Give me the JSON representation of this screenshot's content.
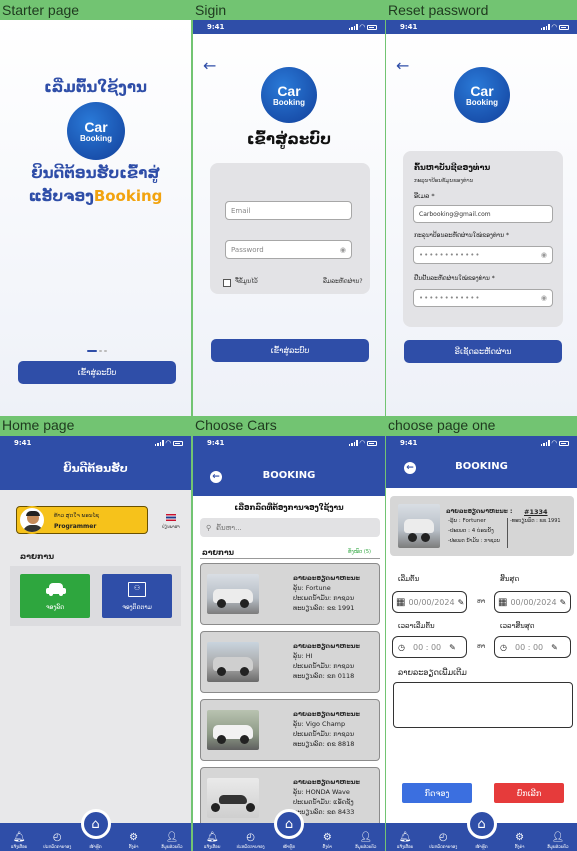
{
  "labels": {
    "starter": "Starter page",
    "signin": "Sigin",
    "reset": "Reset password",
    "home": "Home page",
    "choose": "Choose Cars",
    "choose_one": "choose page one"
  },
  "status": {
    "time": "9:41"
  },
  "logo": {
    "line1": "Car",
    "line2": "Booking"
  },
  "starter": {
    "title_top": "ເລີ່ມຕົ້ນໃຊ້ງານ",
    "welcome_line1": "ຍິນດີຕ້ອນຮັບເຂົ້າສູ່",
    "welcome_line2_prefix": "ແອັບຈອງ",
    "welcome_line2_brand": "Booking",
    "login_button": "ເຂົ້າສູ່ລະບົບ"
  },
  "signin": {
    "title": "ເຂົ້າສູ່ລະບົບ",
    "email_placeholder": "Email",
    "password_placeholder": "Password",
    "remember_label": "ຈື່ຂໍ້ມູນໄວ້",
    "forgot_label": "ລືມລະຫັດຜ່ານ?",
    "login_button": "ເຂົ້າສູ່ລະບົບ"
  },
  "reset": {
    "title": "ຄົ້ນຫາບັນຊີຂອງທ່ານ",
    "subtitle": "ກະລຸນາປ້ອນຂໍ້ມູນຂອງທ່ານ",
    "email_label": "ອີເມລ *",
    "email_value": "Carbooking@gmail.com",
    "new_password_label": "ກະລຸນາປ້ອນລະຫັດຜ່ານໃໝ່ຂອງທ່ານ *",
    "confirm_password_label": "ຢືນຢັນລະຫັດຜ່ານໃໝ່ຂອງທ່ານ *",
    "masked": "••••••••••••",
    "button": "ຣີເຊັດລະຫັດຜ່ານ"
  },
  "home": {
    "header": "ຍິນດີຕ້ອນຮັບ",
    "profile_name": "ທ້າວ ສຸດໃຈ ພອນໄຊ",
    "profile_role": "Programmer",
    "language_label": "ປ່ຽນພາສາ",
    "section_title": "ລາຍການ",
    "tile_book": "ຈອງລົດ",
    "tile_history": "ຈອງຕິດຕາມ"
  },
  "nav": {
    "items": [
      "ແຈ້ງເຕືອນ",
      "ປະຫວັດການຈອງ",
      "ໜ້າຫຼັກ",
      "ຕັ້ງຄ່າ",
      "ຂໍ້ມູນສ່ວນຕົວ"
    ]
  },
  "choose": {
    "header": "BOOKING",
    "subtitle": "ເລືອກລົດທີ່ຕ້ອງການຈອງໃຊ້ງານ",
    "search_placeholder": "ຄົ້ນຫາ...",
    "list_title": "ລາຍການ",
    "count": "ທັງໝົດ (5)",
    "cars": [
      {
        "title": "ລາຍລະອຽດພາຫະນະ",
        "model": "ລຸ້ນ:   Fortune",
        "type": "ປະເພດນ້ຳມັນ:   ກາຊວນ",
        "plate": "ທະບຽນລົດ:   ຂຂ 1991"
      },
      {
        "title": "ລາຍລະອຽດພາຫະນະ",
        "model": "ລຸ້ນ:   HI",
        "type": "ປະເພດນ້ຳມັນ:   ກາຊວນ",
        "plate": "ທະບຽນລົດ:   ຂກ 0118"
      },
      {
        "title": "ລາຍລະອຽດພາຫະນະ",
        "model": "ລຸ້ນ:   Vigo Champ",
        "type": "ປະເພດນ້ຳມັນ:   ກາຊວນ",
        "plate": "ທະບຽນລົດ:   ຄຂ 8818"
      },
      {
        "title": "ລາຍລະອຽດພາຫະນະ",
        "model": "ລຸ້ນ:   HONDA Wave",
        "type": "ປະເພດນ້ຳມັນ:   ແອັດຊັງ",
        "plate": "ທະບຽນລົດ:   ຂຄ 8433"
      }
    ]
  },
  "booking": {
    "header": "BOOKING",
    "detail_title": "ລາຍລະອຽດພາຫະນະ :",
    "detail_id": "#1334",
    "detail_model": "-ລຸ້ນ : Fortuner",
    "detail_seats": "-ປະເພດ : 4 ບ່ອນນັ່ງ",
    "detail_fuel": "-ປະເພດ ນ້ຳມັນ : ກາຊວນ",
    "detail_plate": "-ທະບຽນລົດ : ຂຂ 1991",
    "start_label": "ເລີ່ມຕົ້ນ",
    "end_label": "ສິ້ນສຸດ",
    "date_placeholder": "00/00/2024",
    "to_label": "ຫາ",
    "start_time_label": "ເວລາເລີ່ມຕົ້ນ",
    "end_time_label": "ເວລາສິ້ນສຸດ",
    "time_placeholder": "00 : 00",
    "more_label": "ລາຍລະອຽດເພີ່ມເຕີມ",
    "book_button": "ກົດຈອງ",
    "cancel_button": "ຍົກເລີກ"
  },
  "colors": {
    "background": "#72c472",
    "primary": "#2f4ea8",
    "accent_orange": "#f2a30f",
    "tile_green": "#2ea63e",
    "cancel_red": "#e63b3b",
    "book_blue": "#3b6fe0"
  }
}
